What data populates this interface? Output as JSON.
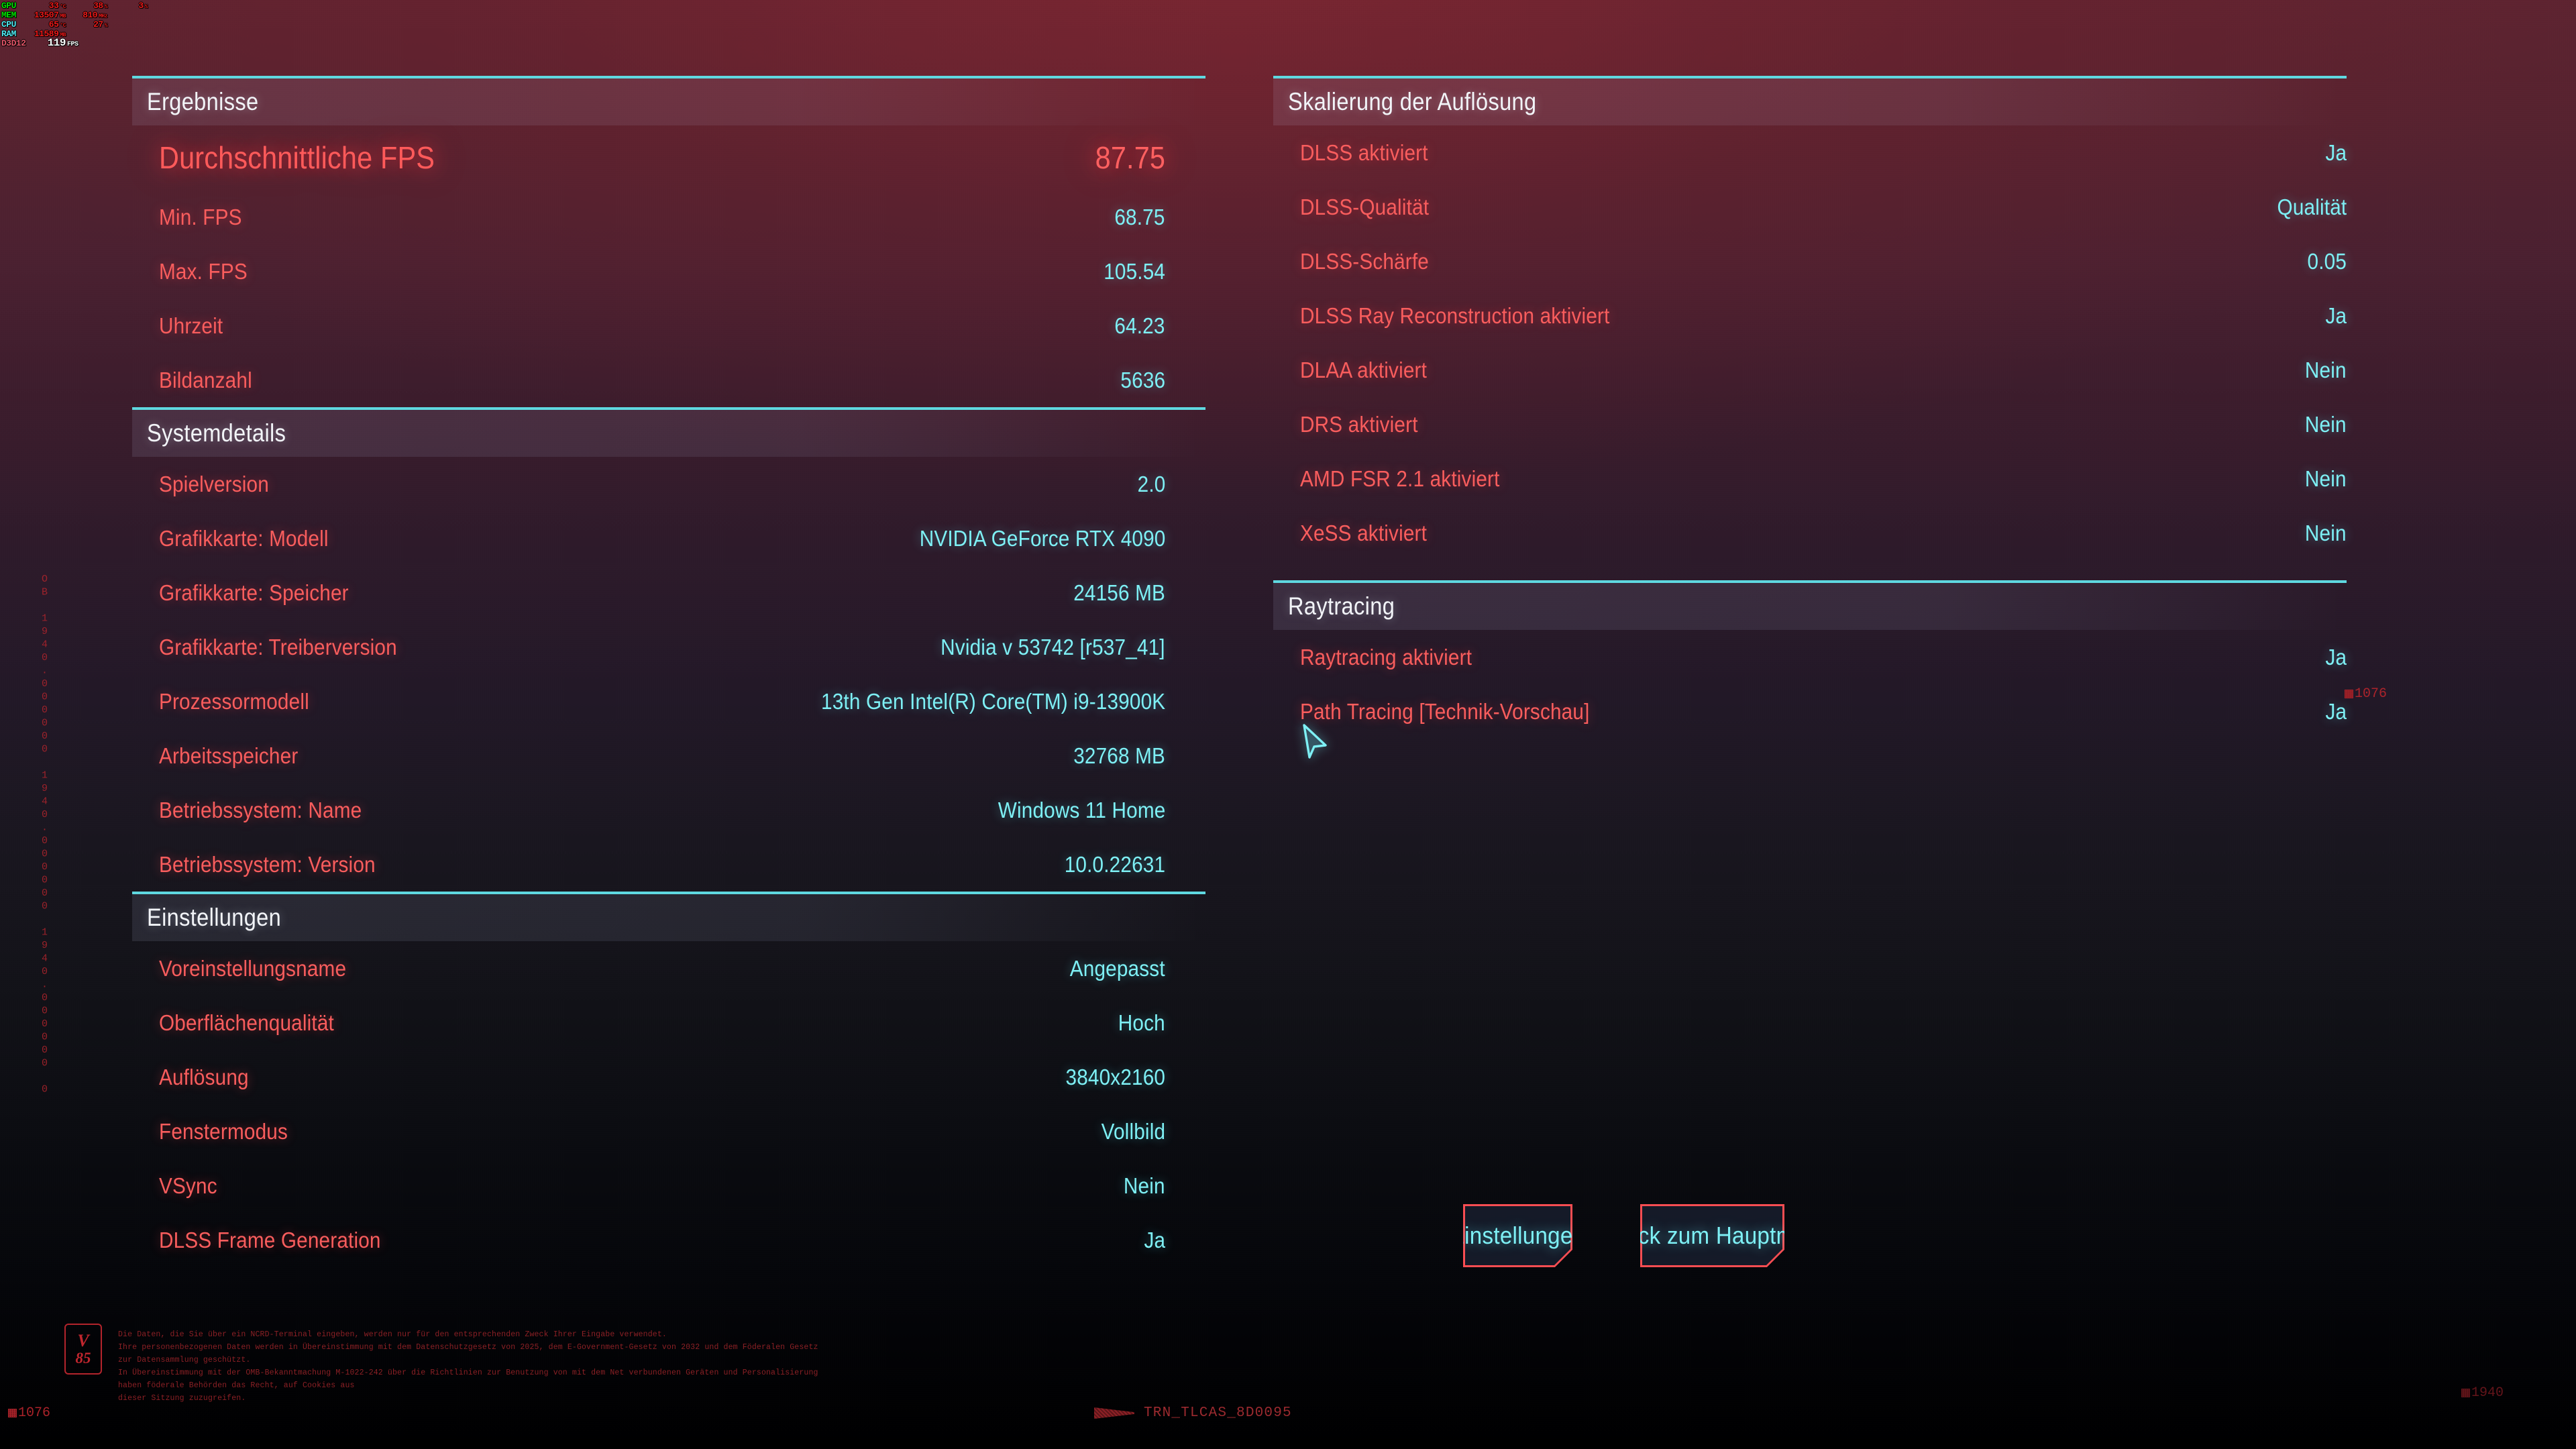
{
  "osd": {
    "rows": [
      {
        "label": "GPU",
        "fields": [
          {
            "value": "33",
            "unit": "°C"
          },
          {
            "value": "38",
            "unit": "%"
          },
          {
            "value": "3",
            "unit": "%"
          }
        ]
      },
      {
        "label": "MEM",
        "fields": [
          {
            "value": "13507",
            "unit": "MB"
          },
          {
            "value": "810",
            "unit": "MHz"
          }
        ]
      },
      {
        "label": "CPU",
        "fields": [
          {
            "value": "65",
            "unit": "°C"
          },
          {
            "value": "27",
            "unit": "%"
          }
        ]
      },
      {
        "label": "RAM",
        "fields": [
          {
            "value": "11589",
            "unit": "MB"
          }
        ]
      }
    ],
    "api_label": "D3D12",
    "fps_value": "119",
    "fps_unit": "FPS"
  },
  "sections": {
    "results": {
      "title": "Ergebnisse",
      "rows": [
        {
          "key": "Durchschnittliche FPS",
          "value": "87.75",
          "hero": true
        },
        {
          "key": "Min. FPS",
          "value": "68.75"
        },
        {
          "key": "Max. FPS",
          "value": "105.54"
        },
        {
          "key": "Uhrzeit",
          "value": "64.23"
        },
        {
          "key": "Bildanzahl",
          "value": "5636"
        }
      ]
    },
    "system": {
      "title": "Systemdetails",
      "rows": [
        {
          "key": "Spielversion",
          "value": "2.0"
        },
        {
          "key": "Grafikkarte: Modell",
          "value": "NVIDIA GeForce RTX 4090"
        },
        {
          "key": "Grafikkarte: Speicher",
          "value": "24156 MB"
        },
        {
          "key": "Grafikkarte: Treiberversion",
          "value": "Nvidia v 53742 [r537_41]"
        },
        {
          "key": "Prozessormodell",
          "value": "13th Gen Intel(R) Core(TM) i9-13900K"
        },
        {
          "key": "Arbeitsspeicher",
          "value": "32768 MB"
        },
        {
          "key": "Betriebssystem: Name",
          "value": "Windows 11 Home"
        },
        {
          "key": "Betriebssystem: Version",
          "value": "10.0.22631"
        }
      ]
    },
    "settings": {
      "title": "Einstellungen",
      "rows": [
        {
          "key": "Voreinstellungsname",
          "value": "Angepasst"
        },
        {
          "key": "Oberflächenqualität",
          "value": "Hoch"
        },
        {
          "key": "Auflösung",
          "value": "3840x2160"
        },
        {
          "key": "Fenstermodus",
          "value": "Vollbild"
        },
        {
          "key": "VSync",
          "value": "Nein"
        },
        {
          "key": "DLSS Frame Generation",
          "value": "Ja"
        }
      ]
    },
    "upscaling": {
      "title": "Skalierung der Auflösung",
      "rows": [
        {
          "key": "DLSS aktiviert",
          "value": "Ja"
        },
        {
          "key": "DLSS-Qualität",
          "value": "Qualität"
        },
        {
          "key": "DLSS-Schärfe",
          "value": "0.05"
        },
        {
          "key": "DLSS Ray Reconstruction aktiviert",
          "value": "Ja"
        },
        {
          "key": "DLAA aktiviert",
          "value": "Nein"
        },
        {
          "key": "DRS aktiviert",
          "value": "Nein"
        },
        {
          "key": "AMD FSR 2.1 aktiviert",
          "value": "Nein"
        },
        {
          "key": "XeSS aktiviert",
          "value": "Nein"
        }
      ]
    },
    "raytracing": {
      "title": "Raytracing",
      "rows": [
        {
          "key": "Raytracing aktiviert",
          "value": "Ja"
        },
        {
          "key": "Path Tracing [Technik-Vorschau]",
          "value": "Ja"
        }
      ]
    }
  },
  "buttons": {
    "settings": "Einstellungen",
    "main_menu": "Zurück zum Hauptmenü"
  },
  "chrome": {
    "vertical_code_left": "OB 1940.000000 1940.000000 1940.000000 0",
    "corner_bottom_left": "1076",
    "corner_right": "1076",
    "corner_bottom_right": "1940",
    "center_tag": "TRN_TLCAS_8D0095"
  },
  "legal": {
    "badge_top": "V",
    "badge_bottom": "85",
    "text": "Die Daten, die Sie über ein NCRD-Terminal eingeben, werden nur für den entsprechenden Zweck Ihrer Eingabe verwendet.\nIhre personenbezogenen Daten werden in Übereinstimmung mit dem Datenschutzgesetz von 2025, dem E-Government-Gesetz von 2032 und dem Föderalen Gesetz zur Datensammlung geschützt.\nIn Übereinstimmung mit der OMB-Bekanntmachung M-1022-242 über die Richtlinien zur Benutzung von mit dem Net verbundenen Geräten und Personalisierung haben föderale Behörden das Recht, auf Cookies aus\ndieser Sitzung zuzugreifen."
  },
  "colors": {
    "accent_cyan": "#7ef0f5",
    "accent_red": "#f95d5d",
    "header_line": "#5fd8e0",
    "button_border": "#fa4d52",
    "chrome_red": "#b3242c"
  }
}
